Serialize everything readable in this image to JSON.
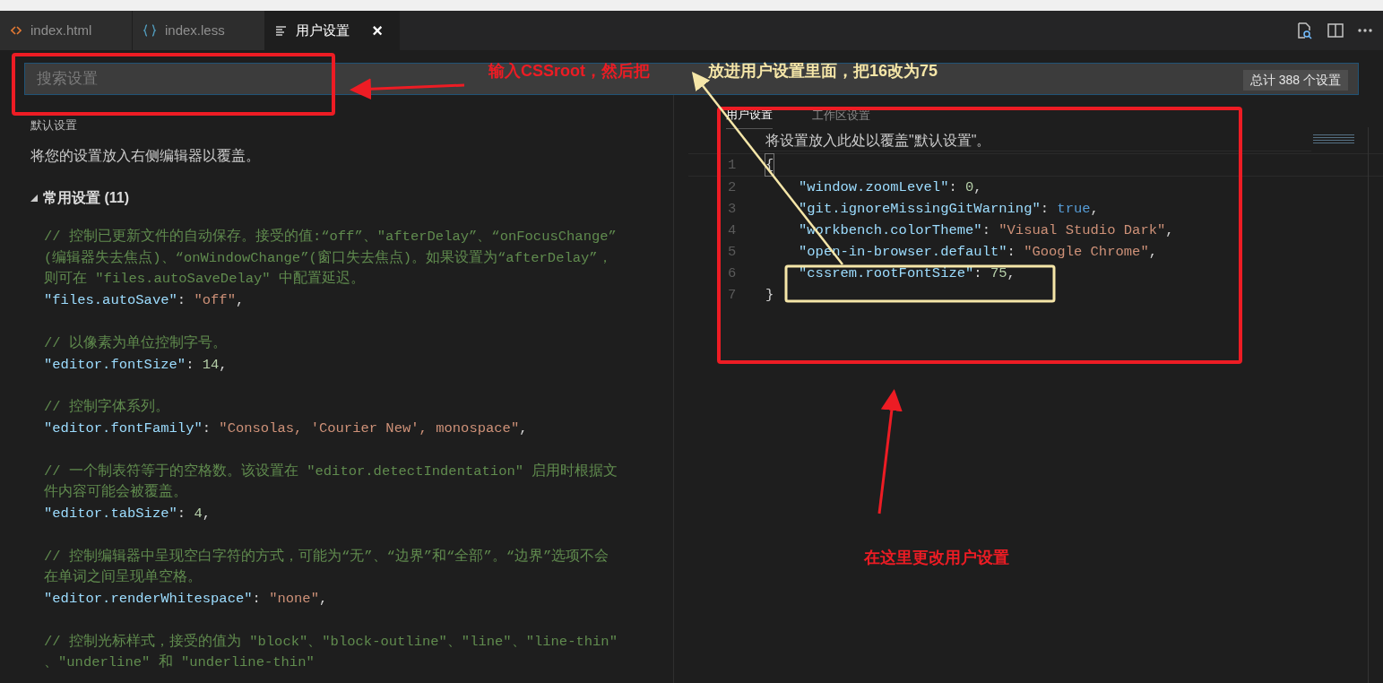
{
  "tabs": [
    {
      "label": "index.html",
      "selected": false,
      "closable": false
    },
    {
      "label": "index.less",
      "selected": false,
      "closable": false
    },
    {
      "label": "用户设置",
      "selected": true,
      "closable": true
    }
  ],
  "close_glyph": "×",
  "search": {
    "placeholder": "搜索设置",
    "count": "总计 388 个设置"
  },
  "default_settings": {
    "title": "默认设置",
    "description": "将您的设置放入右侧编辑器以覆盖。",
    "group": {
      "label": "常用设置 (11)",
      "expanded": true
    },
    "entries": [
      {
        "comment": [
          "// 控制已更新文件的自动保存。接受的值:“off”、\"afterDelay”、“onFocusChange”",
          "(编辑器失去焦点)、“onWindowChange”(窗口失去焦点)。如果设置为“afterDelay”，",
          "则可在 \"files.autoSaveDelay\" 中配置延迟。"
        ],
        "tokens": [
          {
            "kind": "key",
            "text": "\"files.autoSave\""
          },
          {
            "kind": "punct",
            "text": ": "
          },
          {
            "kind": "string",
            "text": "\"off\""
          },
          {
            "kind": "punct",
            "text": ","
          }
        ]
      },
      {
        "comment": [
          "// 以像素为单位控制字号。"
        ],
        "tokens": [
          {
            "kind": "key",
            "text": "\"editor.fontSize\""
          },
          {
            "kind": "punct",
            "text": ": "
          },
          {
            "kind": "number",
            "text": "14"
          },
          {
            "kind": "punct",
            "text": ","
          }
        ]
      },
      {
        "comment": [
          "// 控制字体系列。"
        ],
        "tokens": [
          {
            "kind": "key",
            "text": "\"editor.fontFamily\""
          },
          {
            "kind": "punct",
            "text": ": "
          },
          {
            "kind": "string",
            "text": "\"Consolas, 'Courier New', monospace\""
          },
          {
            "kind": "punct",
            "text": ","
          }
        ]
      },
      {
        "comment": [
          "// 一个制表符等于的空格数。该设置在 \"editor.detectIndentation\" 启用时根据文",
          "件内容可能会被覆盖。"
        ],
        "tokens": [
          {
            "kind": "key",
            "text": "\"editor.tabSize\""
          },
          {
            "kind": "punct",
            "text": ": "
          },
          {
            "kind": "number",
            "text": "4"
          },
          {
            "kind": "punct",
            "text": ","
          }
        ]
      },
      {
        "comment": [
          "// 控制编辑器中呈现空白字符的方式，可能为“无”、“边界”和“全部”。“边界”选项不会",
          "在单词之间呈现单空格。"
        ],
        "tokens": [
          {
            "kind": "key",
            "text": "\"editor.renderWhitespace\""
          },
          {
            "kind": "punct",
            "text": ": "
          },
          {
            "kind": "string",
            "text": "\"none\""
          },
          {
            "kind": "punct",
            "text": ","
          }
        ]
      },
      {
        "comment": [
          "// 控制光标样式，接受的值为 \"block\"、\"block-outline\"、\"line\"、\"line-thin\"",
          "、\"underline\" 和 \"underline-thin\""
        ]
      }
    ]
  },
  "user_settings": {
    "tabs": [
      {
        "label": "用户设置",
        "selected": true
      },
      {
        "label": "工作区设置",
        "selected": false
      }
    ],
    "description": "将设置放入此处以覆盖\"默认设置\"。",
    "lines": [
      {
        "number": "1",
        "tokens": [
          {
            "kind": "punct",
            "text": "{"
          }
        ]
      },
      {
        "number": "2",
        "tokens": [
          {
            "kind": "key",
            "text": "\"window.zoomLevel\""
          },
          {
            "kind": "punct",
            "text": ": "
          },
          {
            "kind": "number",
            "text": "0"
          },
          {
            "kind": "punct",
            "text": ","
          }
        ]
      },
      {
        "number": "3",
        "tokens": [
          {
            "kind": "key",
            "text": "\"git.ignoreMissingGitWarning\""
          },
          {
            "kind": "punct",
            "text": ": "
          },
          {
            "kind": "boolean",
            "text": "true"
          },
          {
            "kind": "punct",
            "text": ","
          }
        ]
      },
      {
        "number": "4",
        "tokens": [
          {
            "kind": "key",
            "text": "\"workbench.colorTheme\""
          },
          {
            "kind": "punct",
            "text": ": "
          },
          {
            "kind": "string",
            "text": "\"Visual Studio Dark\""
          },
          {
            "kind": "punct",
            "text": ","
          }
        ]
      },
      {
        "number": "5",
        "tokens": [
          {
            "kind": "key",
            "text": "\"open-in-browser.default\""
          },
          {
            "kind": "punct",
            "text": ": "
          },
          {
            "kind": "string",
            "text": "\"Google Chrome\""
          },
          {
            "kind": "punct",
            "text": ","
          }
        ]
      },
      {
        "number": "6",
        "tokens": [
          {
            "kind": "key",
            "text": "\"cssrem.rootFontSize\""
          },
          {
            "kind": "punct",
            "text": ": "
          },
          {
            "kind": "number",
            "text": "75"
          },
          {
            "kind": "punct",
            "text": ","
          }
        ]
      },
      {
        "number": "7",
        "tokens": [
          {
            "kind": "punct",
            "text": "}"
          }
        ]
      }
    ]
  },
  "annotations": [
    {
      "text": "输入CSSroot，然后把",
      "color": "#ed1c24"
    },
    {
      "text": "放进用户设置里面，把16改为75",
      "color": "#f5e6a8"
    },
    {
      "text": "在这里更改用户设置",
      "color": "#ed1c24"
    }
  ]
}
